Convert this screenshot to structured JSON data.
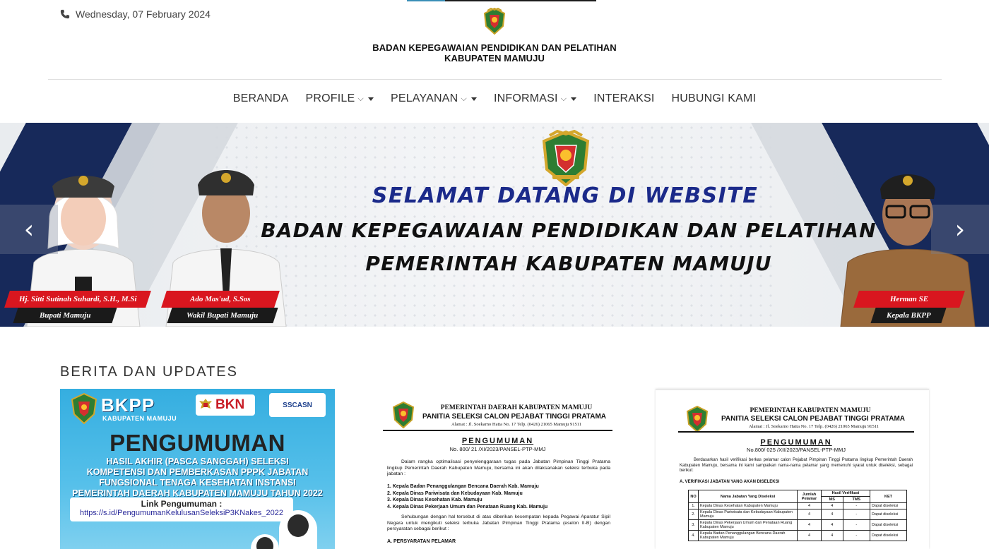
{
  "header": {
    "date": "Wednesday, 07 February 2024",
    "org_line1": "BADAN KEPEGAWAIAN PENDIDIKAN DAN PELATIHAN",
    "org_line2": "KABUPATEN MAMUJU"
  },
  "nav": {
    "items": [
      {
        "label": "BERANDA",
        "dropdown": false
      },
      {
        "label": "PROFILE",
        "dropdown": true
      },
      {
        "label": "PELAYANAN",
        "dropdown": true
      },
      {
        "label": "INFORMASI",
        "dropdown": true
      },
      {
        "label": "INTERAKSI",
        "dropdown": false
      },
      {
        "label": "HUBUNGI KAMI",
        "dropdown": false
      }
    ],
    "chevron": "⌵"
  },
  "banner": {
    "welcome": "SELAMAT DATANG DI WEBSITE",
    "line2": "BADAN KEPEGAWAIAN PENDIDIKAN DAN PELATIHAN",
    "line3": "PEMERINTAH KABUPATEN MAMUJU",
    "people": [
      {
        "name": "Hj. Sitti Sutinah Suhardi, S.H., M.Si",
        "role": "Bupati Mamuju"
      },
      {
        "name": "Ado Mas'ud, S.Sos",
        "role": "Wakil Bupati Mamuju"
      },
      {
        "name": "Herman SE",
        "role": "Kepala BKPP"
      }
    ],
    "prev_arrow": "‹",
    "next_arrow": "›",
    "colors": {
      "navy": "#17295a",
      "red": "#d9161f",
      "welcome": "#1b2a8a"
    }
  },
  "news": {
    "section_title": "BERITA DAN UPDATES",
    "card1": {
      "bkpp": "BKPP",
      "bkpp_sub": "KABUPATEN MAMUJU",
      "bkn": "BKN",
      "asn": "SSCASN",
      "title": "PENGUMUMAN",
      "body_lines": [
        "HASIL AKHIR (PASCA SANGGAH) SELEKSI",
        "KOMPETENSI DAN PEMBERKASAN  PPPK JABATAN",
        "FUNGSIONAL TENAGA KESEHATAN INSTANSI",
        "PEMERINTAH DAERAH KABUPATEN MAMUJU TAHUN 2022"
      ],
      "link_label": "Link Pengumuman  :",
      "link_url": "https://s.id/PengumumanKelulusanSeleksiP3KNakes_2022"
    },
    "card2": {
      "head1": "PEMERINTAH DAERAH KABUPATEN MAMUJU",
      "head2": "PANITIA SELEKSI CALON PEJABAT TINGGI PRATAMA",
      "address": "Alamat : Jl. Soekarno Hatta No. 17 Telp. (0426) 21065 Mamuju 91511",
      "title": "PENGUMUMAN",
      "number": "No. 800/ 21 /XI/2023/PANSEL-PTP-MMJ",
      "para1": "Dalam rangka optimalisasi penyelenggaraan tugas pada Jabatan Pimpinan Tinggi Pratama lingkup Pemerintah Daerah Kabupaten Mamuju, bersama ini akan dilaksanakan seleksi terbuka pada jabatan :",
      "list": [
        "1.  Kepala Badan Penanggulangan Bencana Daerah Kab. Mamuju",
        "2.  Kepala Dinas Pariwisata dan Kebudayaan Kab. Mamuju",
        "3.  Kepala Dinas Kesehatan Kab. Mamuju",
        "4.  Kepala Dinas Pekerjaan Umum dan Penataan Ruang Kab. Mamuju"
      ],
      "para2": "Sehubungan dengan hal tersebut di atas diberikan kesempatan kepada Pegawai Aparatur Sipil Negara untuk mengikuti seleksi terbuka Jabatan Pimpinan Tinggi Pratama (eselon II-B) dengan persyaratan sebagai berikut :",
      "section": "A.   PERSYARATAN PELAMAR"
    },
    "card3": {
      "head1": "PEMERINTAH KABUPATEN MAMUJU",
      "head2": "PANITIA SELEKSI CALON PEJABAT TINGGI PRATAMA",
      "address": "Alamat : Jl. Soekarno Hatta No. 17 Telp. (0426) 21065 Mamuju 91511",
      "title": "PENGUMUMAN",
      "number": "No.800/  025 /XII/2023/PANSEL-PTP-MMJ",
      "para1": "Berdasarkan hasil verifikasi berkas pelamar calon Pejabat Pimpinan Tinggi Pratama lingkup Pemerintah Daerah Kabupaten Mamuju, bersama ini kami sampaikan nama-nama pelamar yang memenuhi syarat untuk diseleksi, sebagai berikut:",
      "section": "A.  VERIFIKASI JABATAN YANG AKAN DISELEKSI",
      "table": {
        "headers": [
          "NO",
          "Nama Jabatan Yang Diseleksi",
          "Jumlah Pelamar",
          "Hasil Verifikasi",
          "KET"
        ],
        "subheaders": [
          "MS",
          "TMS"
        ],
        "rows": [
          [
            "1.",
            "Kepala Dinas Kesehatan Kabupaten Mamuju",
            "4",
            "4",
            "-",
            "Dapat diseleksi"
          ],
          [
            "2.",
            "Kepala Dinas Pariwisata dan Kebudayaan Kabupaten Mamuju",
            "4",
            "4",
            "-",
            "Dapat diseleksi"
          ],
          [
            "3.",
            "Kepala Dinas Pekerjaan Umum dan Penataan Ruang Kabupaten Mamuju",
            "4",
            "4",
            "-",
            "Dapat diseleksi"
          ],
          [
            "4.",
            "Kepala Badan Penanggulangan Bencana Daerah Kabupaten Mamuju",
            "4",
            "4",
            "-",
            "Dapat diseleksi"
          ]
        ]
      }
    }
  }
}
